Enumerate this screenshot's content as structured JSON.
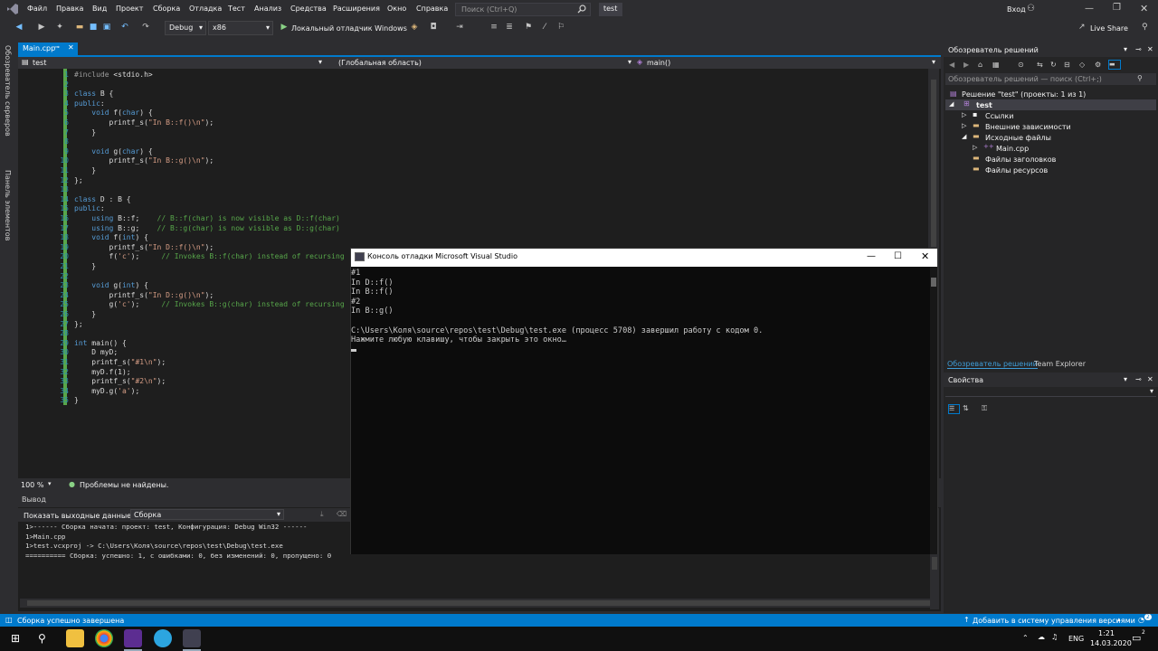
{
  "menu": {
    "items": [
      "Файл",
      "Правка",
      "Вид",
      "Проект",
      "Сборка",
      "Отладка",
      "Тест",
      "Анализ",
      "Средства",
      "Расширения",
      "Окно",
      "Справка"
    ],
    "search_placeholder": "Поиск (Ctrl+Q)",
    "solution_badge": "test",
    "login": "Вход"
  },
  "toolbar": {
    "config": "Debug",
    "platform": "x86",
    "run_label": "Локальный отладчик Windows",
    "live_share": "Live Share"
  },
  "left_tabs": [
    "Обозреватель серверов",
    "Панель элементов"
  ],
  "editor": {
    "tab_label": "Main.cpp",
    "nav_project": "test",
    "nav_scope": "(Глобальная область)",
    "nav_member": "main()",
    "lines": [
      "#include <stdio.h>",
      "",
      "class B {",
      "public:",
      "    void f(char) {",
      "        printf_s(\"In B::f()\\n\");",
      "    }",
      "",
      "    void g(char) {",
      "        printf_s(\"In B::g()\\n\");",
      "    }",
      "};",
      "",
      "class D : B {",
      "public:",
      "    using B::f;    // B::f(char) is now visible as D::f(char)",
      "    using B::g;    // B::g(char) is now visible as D::g(char)",
      "    void f(int) {",
      "        printf_s(\"In D::f()\\n\");",
      "        f('c');     // Invokes B::f(char) instead of recursing",
      "    }",
      "",
      "    void g(int) {",
      "        printf_s(\"In D::g()\\n\");",
      "        g('c');     // Invokes B::g(char) instead of recursing",
      "    }",
      "};",
      "",
      "int main() {",
      "    D myD;",
      "    printf_s(\"#1\\n\");",
      "    myD.f(1);",
      "    printf_s(\"#2\\n\");",
      "    myD.g('a');",
      "}"
    ],
    "zoom": "100 %",
    "issues": "Проблемы не найдены."
  },
  "output": {
    "title": "Вывод",
    "source_label": "Показать выходные данные из:",
    "source_value": "Сборка",
    "lines": [
      "1>------ Сборка начата: проект: test, Конфигурация: Debug Win32 ------",
      "1>Main.cpp",
      "1>test.vcxproj -> C:\\Users\\Коля\\source\\repos\\test\\Debug\\test.exe",
      "========== Сборка: успешно: 1, с ошибками: 0, без изменений: 0, пропущено: 0"
    ]
  },
  "console": {
    "title": "Консоль отладки Microsoft Visual Studio",
    "lines": [
      "#1",
      "In D::f()",
      "In B::f()",
      "#2",
      "In B::g()",
      "",
      "C:\\Users\\Коля\\source\\repos\\test\\Debug\\test.exe (процесс 5708) завершил работу с кодом 0.",
      "Нажмите любую клавишу, чтобы закрыть это окно…"
    ]
  },
  "solution_explorer": {
    "title": "Обозреватель решений",
    "search_placeholder": "Обозреватель решений — поиск (Ctrl+;)",
    "solution": "Решение \"test\" (проекты: 1 из 1)",
    "project": "test",
    "items": [
      "Ссылки",
      "Внешние зависимости",
      "Исходные файлы",
      "Main.cpp",
      "Файлы заголовков",
      "Файлы ресурсов"
    ],
    "tabs": [
      "Обозреватель решений",
      "Team Explorer"
    ]
  },
  "properties": {
    "title": "Свойства"
  },
  "statusbar": {
    "message": "Сборка успешно завершена",
    "vcs": "Добавить в систему управления версиями",
    "badge": "2"
  },
  "taskbar": {
    "lang": "ENG",
    "time": "1:21",
    "date": "14.03.2020",
    "notif": "2"
  },
  "colors": {
    "accent": "#007acc",
    "keyword": "#569cd6",
    "string": "#d69d85",
    "comment": "#57a64a",
    "line_number": "#2b91af"
  }
}
